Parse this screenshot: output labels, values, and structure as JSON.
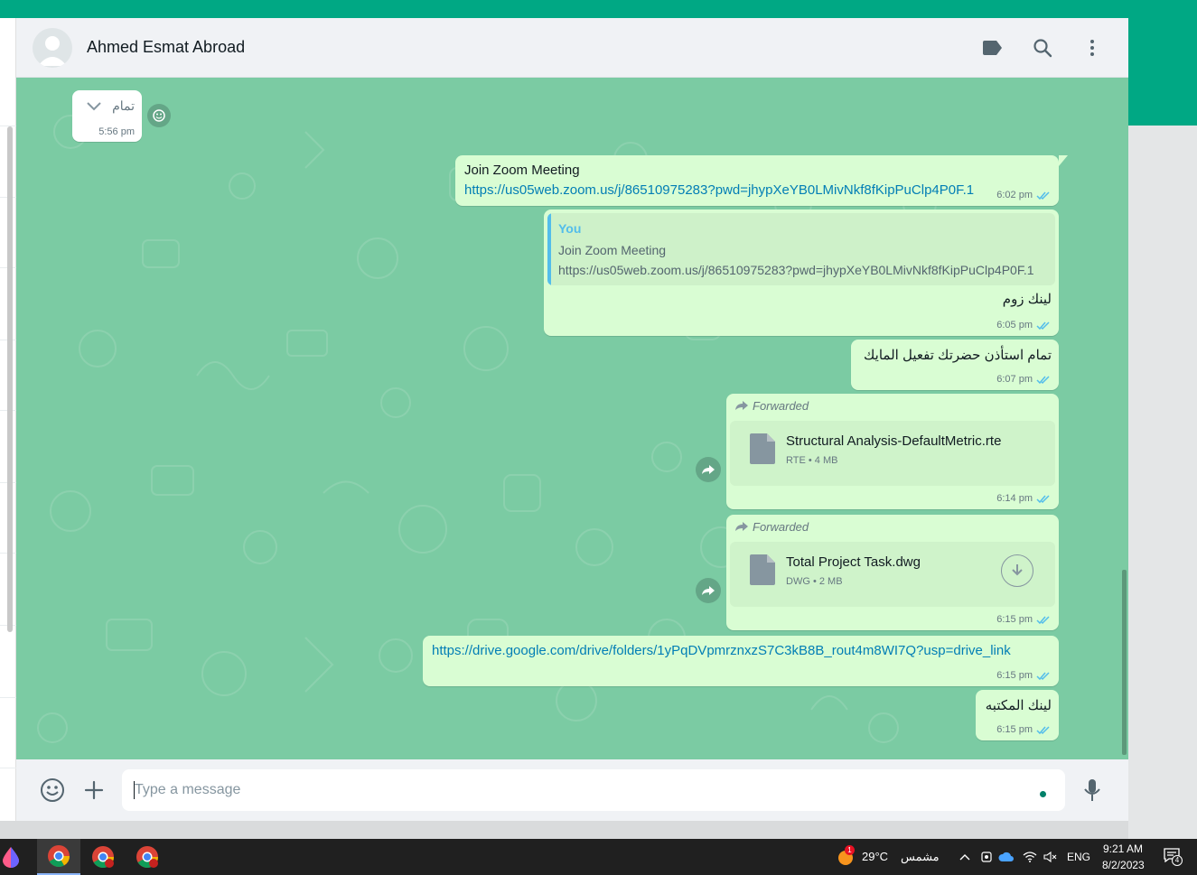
{
  "colors": {
    "whatsapp_green": "#00a884",
    "chat_background": "#7bcba3",
    "outgoing_bubble": "#d9fdd3",
    "incoming_bubble": "#ffffff",
    "link": "#027eb5",
    "read_ticks": "#53bdeb",
    "taskbar": "#202020"
  },
  "header": {
    "contact_name": "Ahmed Esmat Abroad",
    "icons": [
      "default-avatar-icon",
      "label-icon",
      "search-icon",
      "menu-dots-icon"
    ]
  },
  "messages": [
    {
      "type": "incoming",
      "text": "تمام",
      "time": "5:56 pm",
      "icons": [
        "chevron-down-icon",
        "emoji-reaction-icon"
      ]
    },
    {
      "type": "outgoing",
      "line1": "Join Zoom Meeting",
      "link": "https://us05web.zoom.us/j/86510975283?pwd=jhypXeYB0LMivNkf8fKipPuClp4P0F.1",
      "time": "6:02 pm",
      "status": "read"
    },
    {
      "type": "outgoing-reply",
      "quote_author": "You",
      "quote_line1": "Join Zoom Meeting",
      "quote_line2": "https://us05web.zoom.us/j/86510975283?pwd=jhypXeYB0LMivNkf8fKipPuClp4P0F.1",
      "text": "لينك زوم",
      "time": "6:05 pm",
      "status": "read"
    },
    {
      "type": "outgoing",
      "text": "تمام استأذن حضرتك تفعيل المايك",
      "time": "6:07 pm",
      "status": "read"
    },
    {
      "type": "outgoing-document",
      "forwarded_label": "Forwarded",
      "file_name": "Structural Analysis-DefaultMetric.rte",
      "file_type": "RTE",
      "file_size": "4 MB",
      "time": "6:14 pm",
      "status": "read"
    },
    {
      "type": "outgoing-document",
      "forwarded_label": "Forwarded",
      "file_name": "Total Project Task.dwg",
      "file_type": "DWG",
      "file_size": "2 MB",
      "time": "6:15 pm",
      "status": "read",
      "icons": [
        "download-icon"
      ]
    },
    {
      "type": "outgoing",
      "link": "https://drive.google.com/drive/folders/1yPqDVpmrznxzS7C3kB8B_rout4m8WI7Q?usp=drive_link",
      "time": "6:15 pm",
      "status": "read"
    },
    {
      "type": "outgoing",
      "text": "لينك المكتبه",
      "time": "6:15 pm",
      "status": "read"
    }
  ],
  "footer": {
    "placeholder": "Type a message",
    "value": "",
    "icons": [
      "emoji-icon",
      "plus-attach-icon",
      "microphone-icon"
    ]
  },
  "taskbar": {
    "apps": [
      "paint-drop-app-icon",
      "chrome-app-icon",
      "chrome-profile-app-icon",
      "chrome-app-icon"
    ],
    "weather_temp": "29°C",
    "weather_label": "مشمس",
    "weather_badge": "1",
    "language": "ENG",
    "time": "9:21 AM",
    "date": "8/2/2023",
    "notifications_count": "4"
  }
}
